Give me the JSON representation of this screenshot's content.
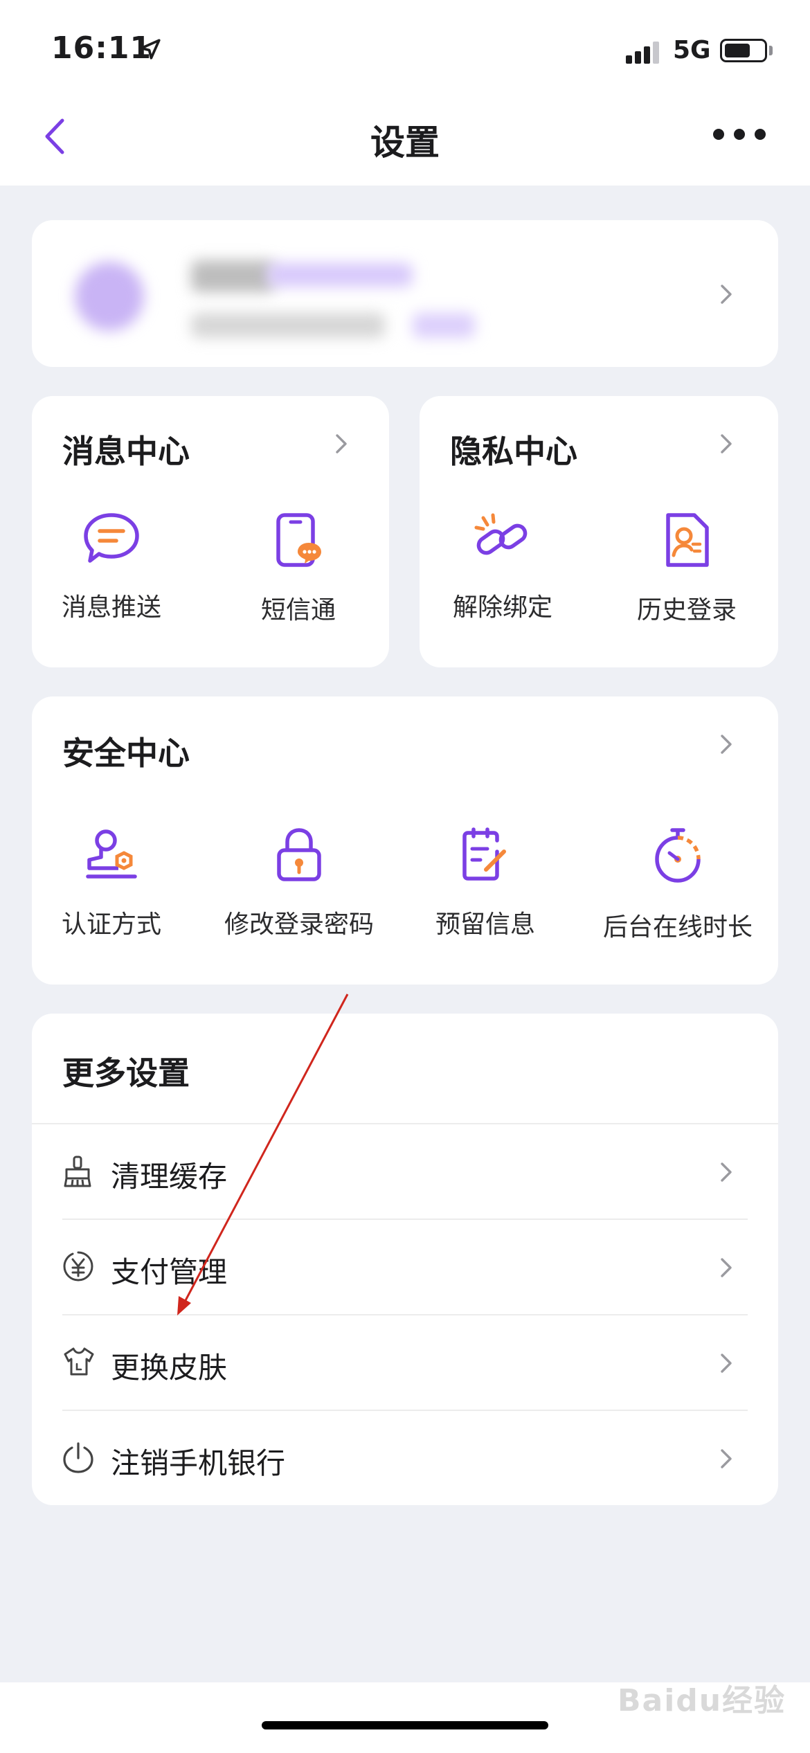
{
  "status_bar": {
    "time": "16:11",
    "network": "5G"
  },
  "header": {
    "title": "设置"
  },
  "message_center": {
    "title": "消息中心",
    "items": [
      {
        "label": "消息推送"
      },
      {
        "label": "短信通"
      }
    ]
  },
  "privacy_center": {
    "title": "隐私中心",
    "items": [
      {
        "label": "解除绑定"
      },
      {
        "label": "历史登录"
      }
    ]
  },
  "security_center": {
    "title": "安全中心",
    "items": [
      {
        "label": "认证方式"
      },
      {
        "label": "修改登录密码"
      },
      {
        "label": "预留信息"
      },
      {
        "label": "后台在线时长"
      }
    ]
  },
  "more_settings": {
    "title": "更多设置",
    "rows": [
      {
        "label": "清理缓存",
        "icon": "broom-icon"
      },
      {
        "label": "支付管理",
        "icon": "yuan-icon"
      },
      {
        "label": "更换皮肤",
        "icon": "shirt-icon"
      },
      {
        "label": "注销手机银行",
        "icon": "power-icon"
      }
    ]
  },
  "watermark": "Baidu经验",
  "colors": {
    "accent": "#7b3fe4",
    "orange": "#f5883a",
    "background": "#eef0f5",
    "annotation_arrow": "#d0261d"
  }
}
